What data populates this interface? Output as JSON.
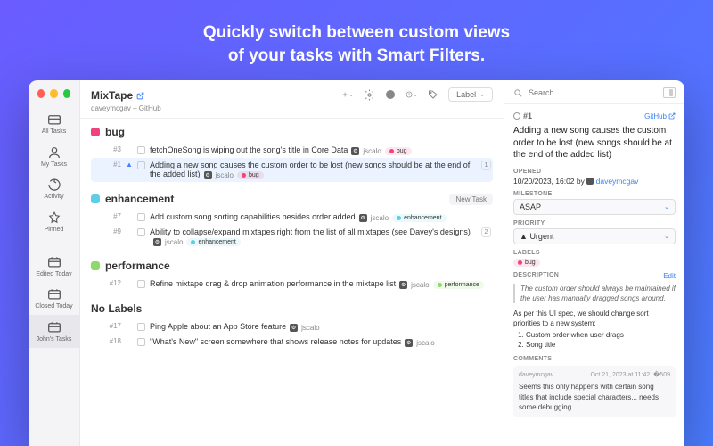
{
  "promo": {
    "line1": "Quickly switch between custom views",
    "line2": "of your tasks with Smart Filters."
  },
  "traffic": {
    "close": "#ff5f57",
    "min": "#febc2e",
    "max": "#28c840"
  },
  "sidebar": {
    "items": [
      {
        "label": "All Tasks"
      },
      {
        "label": "My Tasks"
      },
      {
        "label": "Activity"
      },
      {
        "label": "Pinned"
      }
    ],
    "smart": [
      {
        "label": "Edited Today"
      },
      {
        "label": "Closed Today"
      },
      {
        "label": "John's Tasks"
      }
    ]
  },
  "header": {
    "project": "MixTape",
    "sub": "daveymcgav – GitHub",
    "labelText": "Label"
  },
  "search": {
    "placeholder": "Search"
  },
  "groups": [
    {
      "name": "bug",
      "color": "#ef447a",
      "tasks": [
        {
          "num": "#3",
          "title": "fetchOneSong is wiping out the song's title in Core Data",
          "assignee": "jscalo",
          "tags": [
            {
              "text": "bug",
              "color": "#ef447a"
            }
          ]
        },
        {
          "num": "#1",
          "pri": true,
          "sel": true,
          "title": "Adding a new song causes the custom order to be lost (new songs should be at the end of the added list)",
          "assignee": "jscalo",
          "tags": [
            {
              "text": "bug",
              "color": "#ef447a"
            }
          ],
          "count": "1"
        }
      ]
    },
    {
      "name": "enhancement",
      "color": "#5ccfe6",
      "newTask": "New Task",
      "tasks": [
        {
          "num": "#7",
          "title": "Add custom song sorting capabilities besides order added",
          "assignee": "jscalo",
          "tags": [
            {
              "text": "enhancement",
              "color": "#5ccfe6"
            }
          ]
        },
        {
          "num": "#9",
          "title": "Ability to collapse/expand mixtapes right from the list of all mixtapes (see Davey's designs)",
          "assignee": "jscalo",
          "tags": [
            {
              "text": "enhancement",
              "color": "#5ccfe6"
            }
          ],
          "count": "2"
        }
      ]
    },
    {
      "name": "performance",
      "color": "#8fd96a",
      "tasks": [
        {
          "num": "#12",
          "title": "Refine mixtape drag & drop animation performance in the mixtape list",
          "assignee": "jscalo",
          "tags": [
            {
              "text": "performance",
              "color": "#8fd96a"
            }
          ]
        }
      ]
    },
    {
      "name": "No Labels",
      "nolabel": true,
      "tasks": [
        {
          "num": "#17",
          "title": "Ping Apple about an App Store feature",
          "assignee": "jscalo"
        },
        {
          "num": "#18",
          "title": "\"What's New\" screen somewhere that shows release notes for updates",
          "assignee": "jscalo"
        }
      ]
    }
  ],
  "detail": {
    "issueNum": "#1",
    "ghLink": "GitHub",
    "title": "Adding a new song causes the custom order to be lost (new songs should be at the end of the added list)",
    "opened": {
      "label": "OPENED",
      "date": "10/20/2023, 16:02 by",
      "user": "daveymcgav"
    },
    "milestone": {
      "label": "MILESTONE",
      "value": "ASAP"
    },
    "priority": {
      "label": "PRIORITY",
      "value": "Urgent",
      "icon": "▲"
    },
    "labels": {
      "label": "LABELS",
      "tags": [
        {
          "text": "bug",
          "color": "#ef447a"
        }
      ]
    },
    "description": {
      "label": "DESCRIPTION",
      "edit": "Edit",
      "quote": "The custom order should always be maintained if the user has manually dragged songs around.",
      "body": "As per this UI spec, we should change sort priorities to a new system:",
      "list": [
        "Custom order when user drags",
        "Song title"
      ]
    },
    "comments": {
      "label": "COMMENTS",
      "items": [
        {
          "user": "daveymcgav",
          "date": "Oct 21, 2023 at 11:42",
          "body": "Seems this only happens with certain song titles that include special characters... needs some debugging."
        }
      ]
    }
  }
}
